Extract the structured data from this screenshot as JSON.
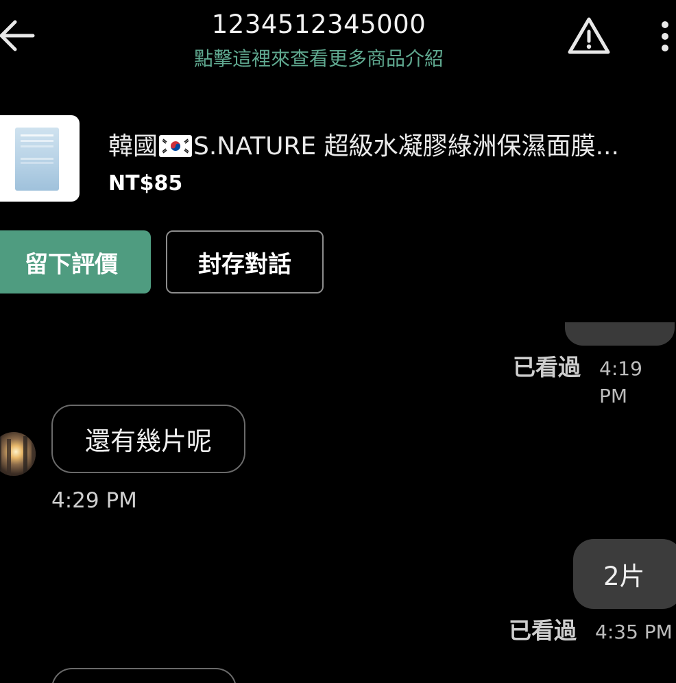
{
  "header": {
    "title": "1234512345000",
    "subtitle": "點擊這裡來查看更多商品介紹",
    "icons": {
      "back": "back-arrow-icon",
      "warning": "warning-icon",
      "more": "more-vertical-icon"
    }
  },
  "product": {
    "name_prefix": "韓國",
    "flag": "korea-flag-icon",
    "name_suffix": "S.NATURE 超級水凝膠綠洲保濕面膜...",
    "price": "NT$85"
  },
  "actions": {
    "leave_review": "留下評價",
    "archive_chat": "封存對話"
  },
  "messages": [
    {
      "direction": "out",
      "text": "",
      "seen_label": "已看過",
      "time": "4:19 PM"
    },
    {
      "direction": "in",
      "text": "還有幾片呢",
      "time": "4:29 PM"
    },
    {
      "direction": "out",
      "text": "2片",
      "seen_label": "已看過",
      "time": "4:35 PM"
    },
    {
      "direction": "in",
      "text": ""
    }
  ],
  "colors": {
    "accent": "#4f9c80",
    "subtitle": "#5fa88f",
    "background": "#000000",
    "outgoing_bubble": "#3c3c3c"
  }
}
